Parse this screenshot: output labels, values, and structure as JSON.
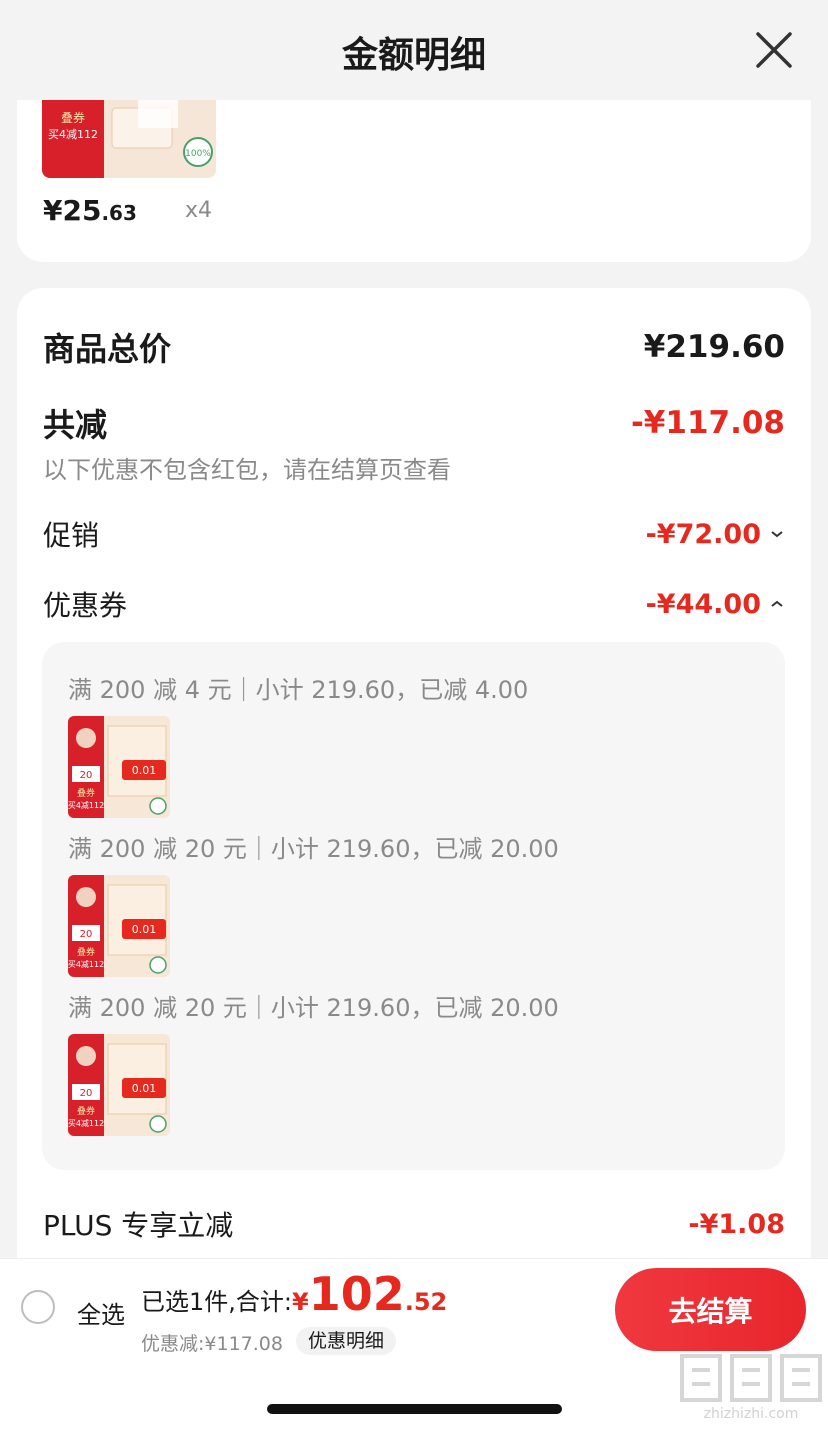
{
  "header": {
    "title": "金额明细"
  },
  "top_item": {
    "price_int": "¥25",
    "price_dec": ".63",
    "qty": "x4",
    "thumb_text_1": "叠券",
    "thumb_text_2": "买4减112",
    "badge": "100%"
  },
  "summary_card": {
    "goods_total_label": "商品总价",
    "goods_total_value": "¥219.60",
    "total_discount_label": "共减",
    "total_discount_value": "-¥117.08",
    "note": "以下优惠不包含红包，请在结算页查看",
    "promo_label": "促销",
    "promo_value": "-¥72.00",
    "coupon_label": "优惠券",
    "coupon_value": "-¥44.00",
    "coupons": [
      {
        "line": "满 200 减 4 元｜小计 219.60，已减 4.00"
      },
      {
        "line": "满 200 减 20 元｜小计 219.60，已减 20.00"
      },
      {
        "line": "满 200 减 20 元｜小计 219.60，已减 20.00"
      }
    ],
    "coupon_thumb": {
      "text_1": "叠券",
      "text_2": "买4减112",
      "text_3": "0.01",
      "text_4": "20"
    },
    "plus_label": "PLUS 专享立减",
    "plus_value": "-¥1.08"
  },
  "bottom_bar": {
    "select_all": "全选",
    "selected_label": "已选1件,合计:",
    "currency": "¥",
    "total_int": "102",
    "total_dec": ".52",
    "discount_info": "优惠减:¥117.08",
    "detail_chip": "优惠明细",
    "checkout": "去结算"
  },
  "watermark": {
    "text": "zhizhizhi.com"
  },
  "colors": {
    "accent_red": "#e6291f",
    "background": "#f3f3f3",
    "muted": "#8a8a8a"
  }
}
